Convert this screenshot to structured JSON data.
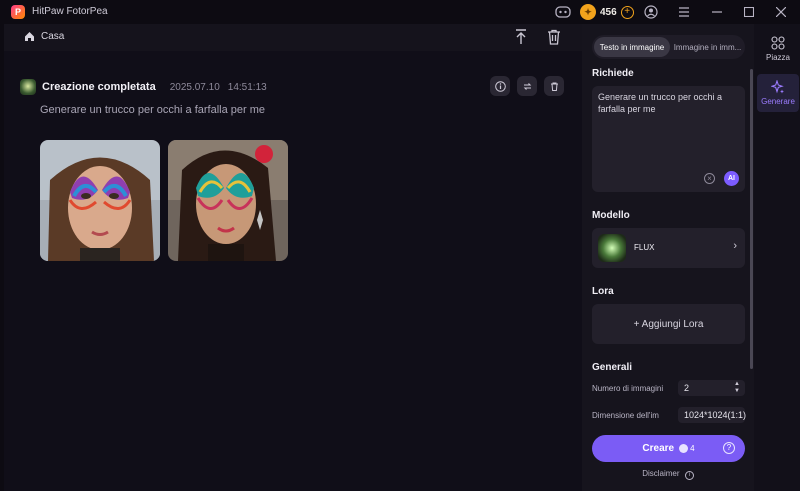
{
  "window": {
    "title": "HitPaw FotorPea",
    "logo_letter": "P"
  },
  "titlebar": {
    "coin_count": "456"
  },
  "breadcrumb": {
    "home_label": "Casa"
  },
  "result": {
    "title": "Creazione completata",
    "date": "2025.07.10",
    "time": "14:51:13",
    "prompt": "Generare un trucco per occhi a farfalla per me"
  },
  "panel": {
    "tabs": [
      "Testo in immagine",
      "Immagine in imm..."
    ],
    "prompt_section": "Richiede",
    "prompt_value": "Generare un trucco per occhi a farfalla per me",
    "ai_label": "AI",
    "model_section": "Modello",
    "model_name": "FLUX",
    "lora_section": "Lora",
    "add_lora": "+ Aggiungi Lora",
    "general_section": "Generali",
    "num_images_label": "Numero di immagini",
    "num_images_value": "2",
    "size_label": "Dimensione dell'im",
    "size_value": "1024*1024(1:1)",
    "create_label": "Creare",
    "create_cost": "4",
    "disclaimer": "Disclaimer"
  },
  "rail": {
    "items": [
      {
        "label": "Piazza",
        "icon": "grid-icon"
      },
      {
        "label": "Generare",
        "icon": "sparkle-icon"
      }
    ]
  },
  "colors": {
    "accent": "#7b5cf5",
    "coin": "#f2a31c"
  }
}
